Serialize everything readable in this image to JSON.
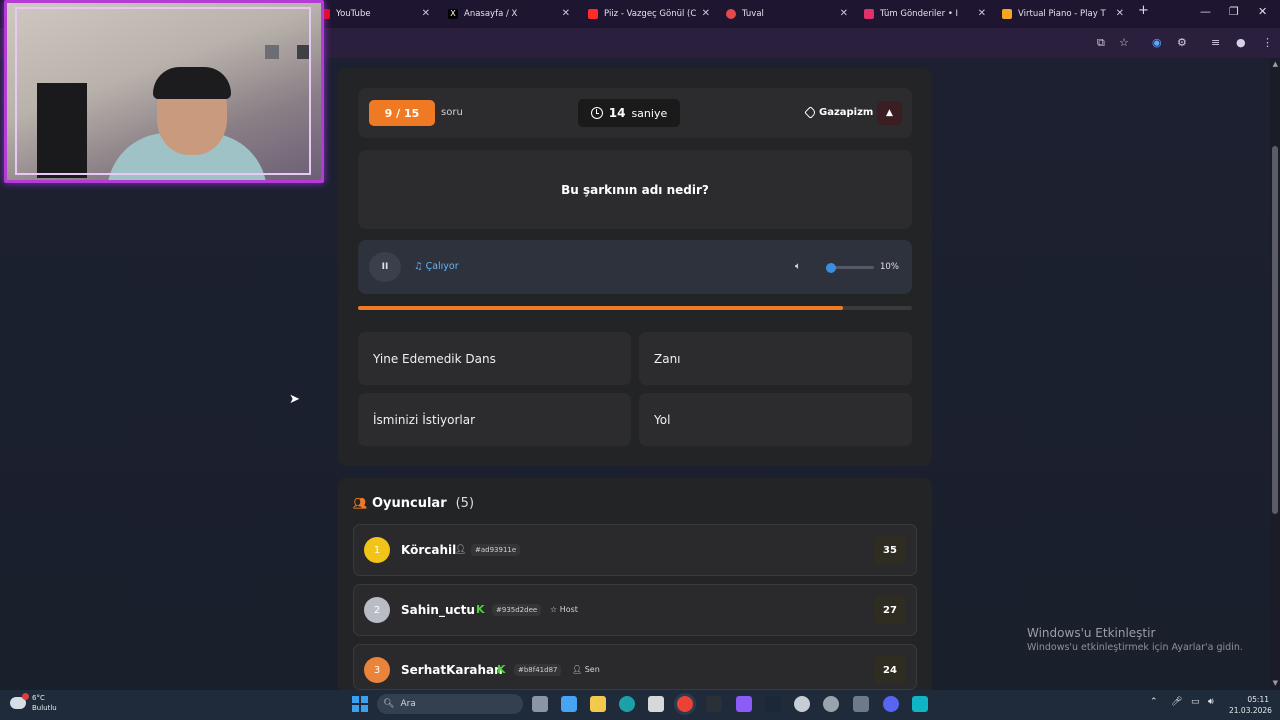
{
  "browser": {
    "tabs": [
      {
        "title": "YouTube",
        "color": "#ff0000"
      },
      {
        "title": "Anasayfa / X",
        "color": "#ffffff"
      },
      {
        "title": "Piiz - Vazgeç Gönül (Cove",
        "color": "#ff2a2a"
      },
      {
        "title": "Tuval",
        "color": "#e5484d"
      },
      {
        "title": "Tüm Gönderiler • Insta",
        "color": "#e1306c"
      },
      {
        "title": "Virtual Piano - Play The B",
        "color": "#f5a623"
      }
    ],
    "new_tab": "+"
  },
  "quiz": {
    "counter": "9 / 15",
    "counter_suffix": "soru",
    "timer_value": "14",
    "timer_unit": "saniye",
    "category": "Gazapizm",
    "question": "Bu şarkının adı nedir?",
    "player_status": "Çalıyor",
    "pause_symbol": "II",
    "volume_percent": 10,
    "volume_label": "10%",
    "progress_fraction": 0.875,
    "answers": [
      "Yine Edemedik Dans",
      "Zanı",
      "İsminizi İstiyorlar",
      "Yol"
    ]
  },
  "players": {
    "title": "Oyuncular",
    "count": "(5)",
    "list": [
      {
        "rank": "1",
        "name": "Körcahil",
        "id": "#ad93911e",
        "badge": "",
        "score": "35",
        "rank_color": "#f2c318"
      },
      {
        "rank": "2",
        "name": "Sahin_uctu",
        "id": "#935d2dee",
        "badge": "Host",
        "score": "27",
        "rank_color": "#b9bcc4"
      },
      {
        "rank": "3",
        "name": "SerhatKarahan",
        "id": "#b8f41d87",
        "badge": "Sen",
        "score": "24",
        "rank_color": "#e9843a"
      }
    ]
  },
  "windows": {
    "activate_title": "Windows'u Etkinleştir",
    "activate_sub": "Windows'u etkinleştirmek için Ayarlar'a gidin.",
    "weather_temp": "6°C",
    "weather_desc": "Bulutlu",
    "search_placeholder": "Ara",
    "time": "05:11",
    "date": "21.03.2026"
  },
  "colors": {
    "accent": "#f07a23",
    "link_blue": "#6ab3f0",
    "webcam_border": "#b43bd6"
  }
}
